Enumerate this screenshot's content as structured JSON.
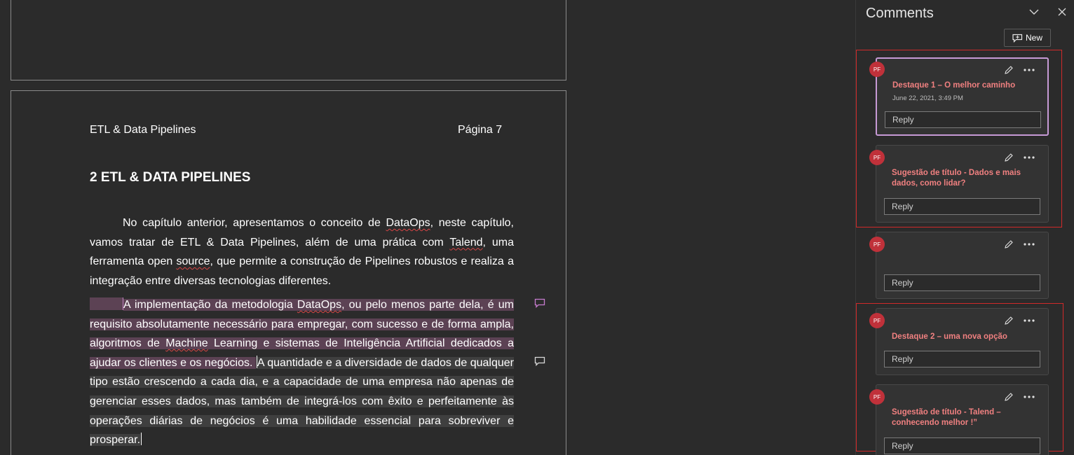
{
  "document": {
    "header_title": "ETL & Data Pipelines",
    "header_page": "Página 7",
    "chapter_title": "2 ETL & DATA PIPELINES",
    "para1": {
      "t1": "No capítulo anterior, apresentamos o conceito de ",
      "w1": "DataOps",
      "t2": ", neste capítulo, vamos tratar de ETL & Data Pipelines, além de uma prática com ",
      "w2": "Talend",
      "t3": ", uma ferramenta open ",
      "w3": "source",
      "t4": ", que permite a construção de Pipelines robustos e realiza a integração entre diversas tecnologias diferentes."
    },
    "para2": {
      "t1": "A implementação da metodologia ",
      "w1": "DataOps",
      "t2": ", ou pelo menos parte dela, é um requisito absolutamente necessário para empregar, com sucesso e de forma ampla, algoritmos de ",
      "w2": "Machine",
      "t3": " Learning e sistemas de Inteligência Artificial dedicados a ajudar os clientes e os negócios. ",
      "t4": "A quantidade e a diversidade de dados de qualquer tipo estão crescendo a cada dia, e a capacidade de uma empresa não apenas de gerenciar esses dados, mas também de integrá-los com êxito e perfeitamente às operações diárias de negócios é uma habilidade essencial para sobreviver e prosperar."
    }
  },
  "comments_pane": {
    "title": "Comments",
    "new_label": "New",
    "reply_placeholder": "Reply",
    "comments": [
      {
        "author_initials": "PF",
        "text": "Destaque 1 –  O melhor caminho",
        "date": "June 22, 2021, 3:49 PM"
      },
      {
        "author_initials": "PF",
        "text": "Sugestão de título  - Dados e mais dados, como lidar?"
      },
      {
        "author_initials": "PF",
        "text": ""
      },
      {
        "author_initials": "PF",
        "text": "Destaque 2 – uma nova opção"
      },
      {
        "author_initials": "PF",
        "text": "Sugestão de título -  Talend – conhecendo melhor !”"
      }
    ]
  },
  "colors": {
    "background": "#2b2b2b",
    "highlight_active": "#5c4254",
    "highlight_inactive": "#3f3f3f",
    "comment_text": "#f08080",
    "avatar": "#c0313a",
    "active_card_border": "#c79ad6",
    "group_outline": "#d02a2a"
  },
  "icons": [
    "comment-icon",
    "chevron-down-icon",
    "close-icon",
    "new-comment-icon",
    "edit-icon",
    "more-options-icon"
  ]
}
